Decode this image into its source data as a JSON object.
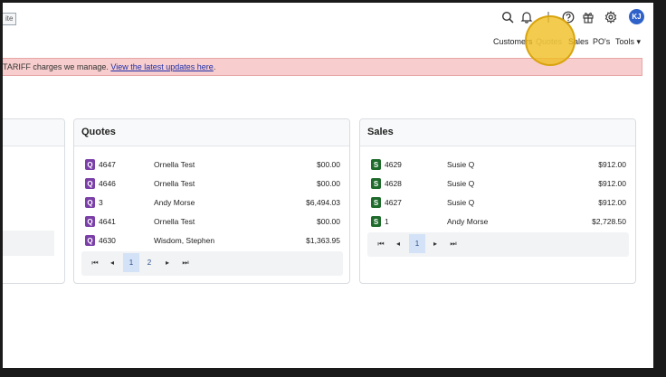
{
  "topbar": {
    "title_fragment": "ite",
    "avatar_initials": "KJ",
    "icons": [
      "search-icon",
      "bell-icon",
      "separator",
      "help-icon",
      "gift-icon",
      "gear-icon"
    ]
  },
  "nav": {
    "items": [
      {
        "label": "Customers"
      },
      {
        "label": "Quotes",
        "active": true
      },
      {
        "label": "Sales"
      },
      {
        "label": "PO's"
      },
      {
        "label": "Tools ▾"
      }
    ]
  },
  "banner": {
    "text": "TARIFF charges we manage. ",
    "link": "View the latest updates here",
    "suffix": "."
  },
  "quotes": {
    "title": "Quotes",
    "rows": [
      {
        "badge": "Q",
        "number": "4647",
        "name": "Ornella Test",
        "amount": "$00.00"
      },
      {
        "badge": "Q",
        "number": "4646",
        "name": "Ornella Test",
        "amount": "$00.00"
      },
      {
        "badge": "Q",
        "number": "3",
        "name": "Andy Morse",
        "amount": "$6,494.03"
      },
      {
        "badge": "Q",
        "number": "4641",
        "name": "Ornella Test",
        "amount": "$00.00"
      },
      {
        "badge": "Q",
        "number": "4630",
        "name": "Wisdom, Stephen",
        "amount": "$1,363.95"
      }
    ],
    "pager": {
      "first": "⏮",
      "prev": "◂",
      "pages": [
        "1",
        "2"
      ],
      "next": "▸",
      "last": "⏭"
    }
  },
  "sales": {
    "title": "Sales",
    "rows": [
      {
        "badge": "S",
        "number": "4629",
        "name": "Susie Q",
        "amount": "$912.00"
      },
      {
        "badge": "S",
        "number": "4628",
        "name": "Susie Q",
        "amount": "$912.00"
      },
      {
        "badge": "S",
        "number": "4627",
        "name": "Susie Q",
        "amount": "$912.00"
      },
      {
        "badge": "S",
        "number": "1",
        "name": "Andy Morse",
        "amount": "$2,728.50"
      }
    ],
    "pager": {
      "first": "⏮",
      "prev": "◂",
      "pages": [
        "1"
      ],
      "next": "▸",
      "last": "⏭"
    }
  },
  "colors": {
    "banner_bg": "#f7cdcd",
    "quote_badge": "#7b3fa8",
    "sale_badge": "#1f6b2c",
    "avatar": "#2f62c9",
    "highlight": "#f0be1e"
  }
}
